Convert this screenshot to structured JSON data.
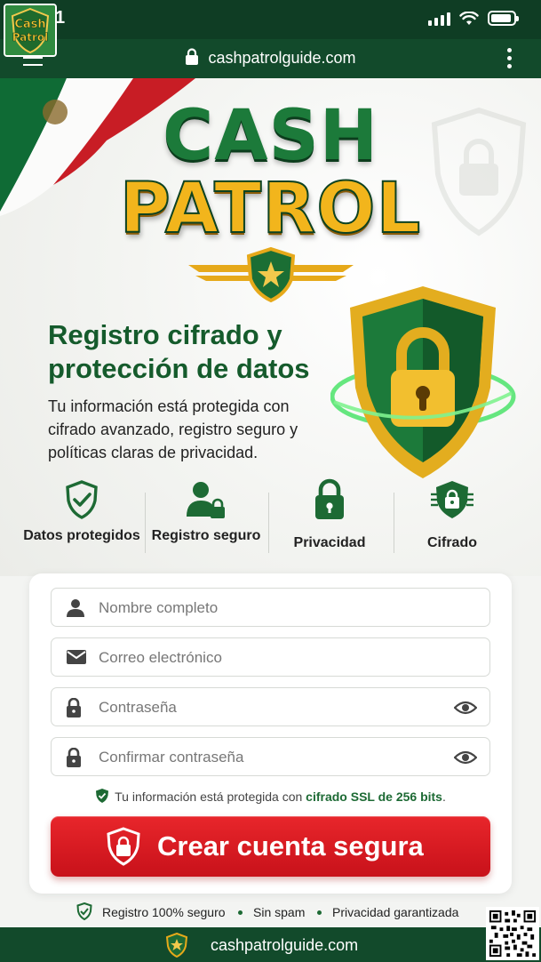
{
  "status": {
    "time": "1"
  },
  "browser": {
    "url": "cashpatrolguide.com"
  },
  "logo": {
    "line1": "Cash",
    "line2": "Patrol"
  },
  "hero": {
    "brand_top": "CASH",
    "brand_bottom": "PATROL",
    "headline": "Registro cifrado y protección de datos",
    "subtext": "Tu información está protegida con cifrado avanzado, registro seguro y políticas claras de privacidad."
  },
  "features": [
    {
      "label": "Datos protegidos",
      "icon": "shield-check-icon"
    },
    {
      "label": "Registro seguro",
      "icon": "user-lock-icon"
    },
    {
      "label": "Privacidad",
      "icon": "padlock-icon"
    },
    {
      "label": "Cifrado",
      "icon": "chip-lock-icon"
    }
  ],
  "form": {
    "name_placeholder": "Nombre completo",
    "email_placeholder": "Correo electrónico",
    "password_placeholder": "Contraseña",
    "confirm_placeholder": "Confirmar contraseña",
    "ssl_prefix": "Tu información está protegida con",
    "ssl_strong": "cifrado SSL de 256 bits",
    "ssl_suffix": ".",
    "submit_label": "Crear cuenta segura"
  },
  "trust": {
    "item1": "Registro 100% seguro",
    "item2": "Sin spam",
    "item3": "Privacidad garantizada"
  },
  "footer": {
    "url": "cashpatrolguide.com"
  },
  "colors": {
    "brand_green": "#155b2c",
    "brand_gold": "#f2b51c",
    "cta_red": "#d9191f",
    "chrome_green": "#124a2b"
  }
}
